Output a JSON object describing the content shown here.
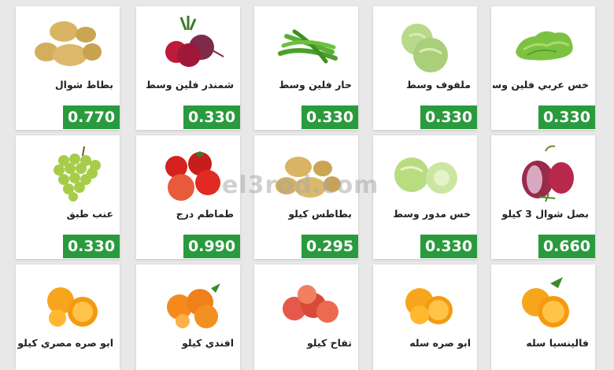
{
  "products": [
    {
      "name": "خس عربي فلين وسط",
      "price": "0.330",
      "icon": "lettuce-icon"
    },
    {
      "name": "ملفوف وسط",
      "price": "0.330",
      "icon": "cabbage-icon"
    },
    {
      "name": "حار فلين وسط",
      "price": "0.330",
      "icon": "green-beans-icon"
    },
    {
      "name": "شمندر فلين وسط",
      "price": "0.330",
      "icon": "beetroot-icon"
    },
    {
      "name": "بطاط شوال",
      "price": "0.770",
      "icon": "potato-icon"
    },
    {
      "name": "بصل شوال 3 كيلو",
      "price": "0.660",
      "icon": "red-onion-icon"
    },
    {
      "name": "خس مدور وسط",
      "price": "0.330",
      "icon": "iceberg-lettuce-icon"
    },
    {
      "name": "بطاطس كيلو",
      "price": "0.295",
      "icon": "potato-icon"
    },
    {
      "name": "طماطم درج",
      "price": "0.990",
      "icon": "tomato-icon"
    },
    {
      "name": "عنب طبق",
      "price": "0.330",
      "icon": "grapes-icon"
    },
    {
      "name": "فالينسيا سله",
      "price": "",
      "icon": "valencia-orange-icon"
    },
    {
      "name": "ابو صره سله",
      "price": "",
      "icon": "navel-orange-icon"
    },
    {
      "name": "تفاح كيلو",
      "price": "",
      "icon": "apple-icon"
    },
    {
      "name": "افندي كيلو",
      "price": "",
      "icon": "mandarin-icon"
    },
    {
      "name": "ابو صره مصري كيلو",
      "price": "",
      "icon": "orange-icon"
    }
  ],
  "watermark": "el3rod.com",
  "colors": {
    "price_badge": "#2a9a3e",
    "background": "#e8e8e8",
    "card": "#ffffff"
  }
}
